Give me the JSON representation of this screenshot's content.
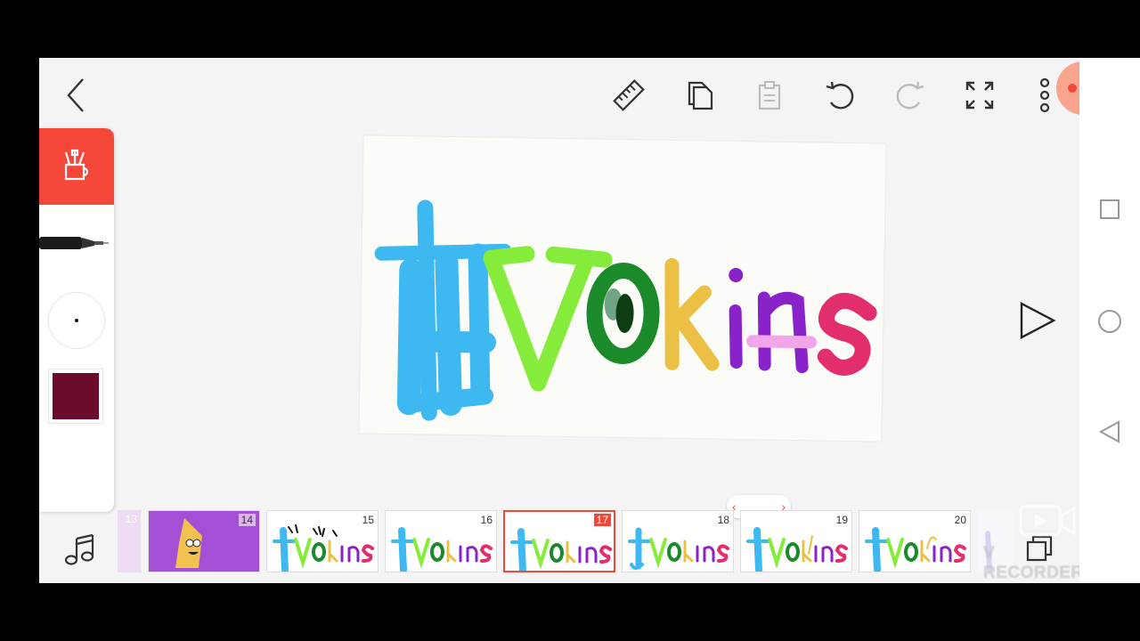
{
  "toolbar": {
    "icons": [
      "back-arrow-icon",
      "ruler-icon",
      "copy-icon",
      "paste-icon",
      "undo-icon",
      "redo-icon",
      "fullscreen-icon",
      "more-icon"
    ]
  },
  "tool_panel": {
    "brush_size_label": "",
    "selected_color": "#6b0d2a",
    "accent_color": "#f4473a"
  },
  "canvas": {
    "drawing_text": "Vokins"
  },
  "filmstrip": {
    "frames": [
      {
        "number": "13"
      },
      {
        "number": "14"
      },
      {
        "number": "15"
      },
      {
        "number": "16"
      },
      {
        "number": "17",
        "selected": true
      },
      {
        "number": "18"
      },
      {
        "number": "19"
      },
      {
        "number": "20"
      }
    ],
    "scrub_left": "‹",
    "scrub_right": "›"
  },
  "watermark": {
    "text": "V RECORDER"
  }
}
